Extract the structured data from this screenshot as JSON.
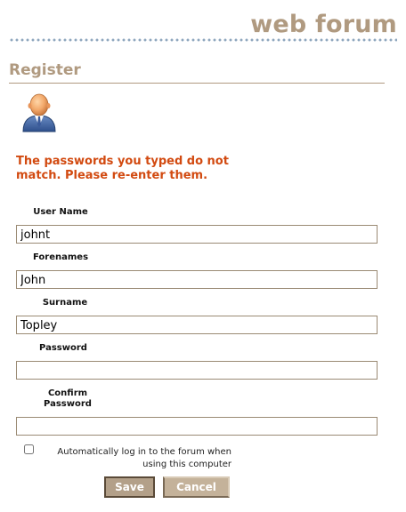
{
  "site": {
    "title": "web forum"
  },
  "page": {
    "heading": "Register"
  },
  "avatar_icon": "user-avatar-icon",
  "error": {
    "message": "The passwords you typed do not match. Please re-enter them."
  },
  "form": {
    "username": {
      "label": "User Name",
      "value": "johnt"
    },
    "forenames": {
      "label": "Forenames",
      "value": "John"
    },
    "surname": {
      "label": "Surname",
      "value": "Topley"
    },
    "password": {
      "label": "Password",
      "value": ""
    },
    "confirm_password": {
      "label": "Confirm Password",
      "value": ""
    },
    "auto_login": {
      "label": "Automatically log in to the forum when using this computer",
      "checked": false
    }
  },
  "buttons": {
    "save": "Save",
    "cancel": "Cancel"
  },
  "colors": {
    "brand": "#b09a80",
    "error": "#d24a10",
    "dots": "#8ea6bd",
    "save_bg": "#b3a089",
    "cancel_bg": "#c4b29a"
  }
}
